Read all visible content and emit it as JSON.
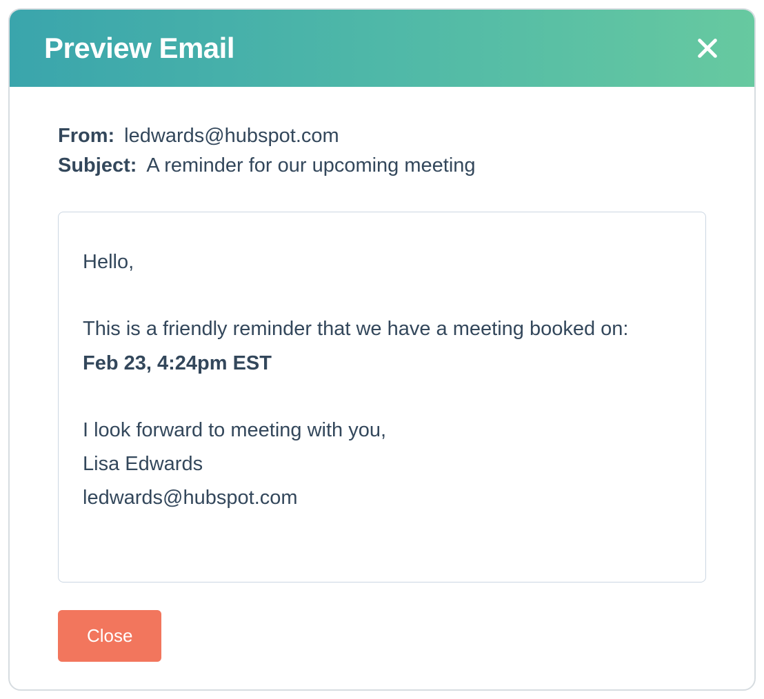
{
  "header": {
    "title": "Preview Email"
  },
  "meta": {
    "from_label": "From:",
    "from_value": "ledwards@hubspot.com",
    "subject_label": "Subject:",
    "subject_value": "A reminder for our upcoming meeting"
  },
  "body": {
    "greeting": "Hello,",
    "intro": "This is a friendly reminder that we have a meeting booked on:",
    "datetime": "Feb 23, 4:24pm EST",
    "signoff": "I look forward to meeting with you,",
    "signature_name": "Lisa Edwards",
    "signature_email": "ledwards@hubspot.com"
  },
  "footer": {
    "close_label": "Close"
  }
}
